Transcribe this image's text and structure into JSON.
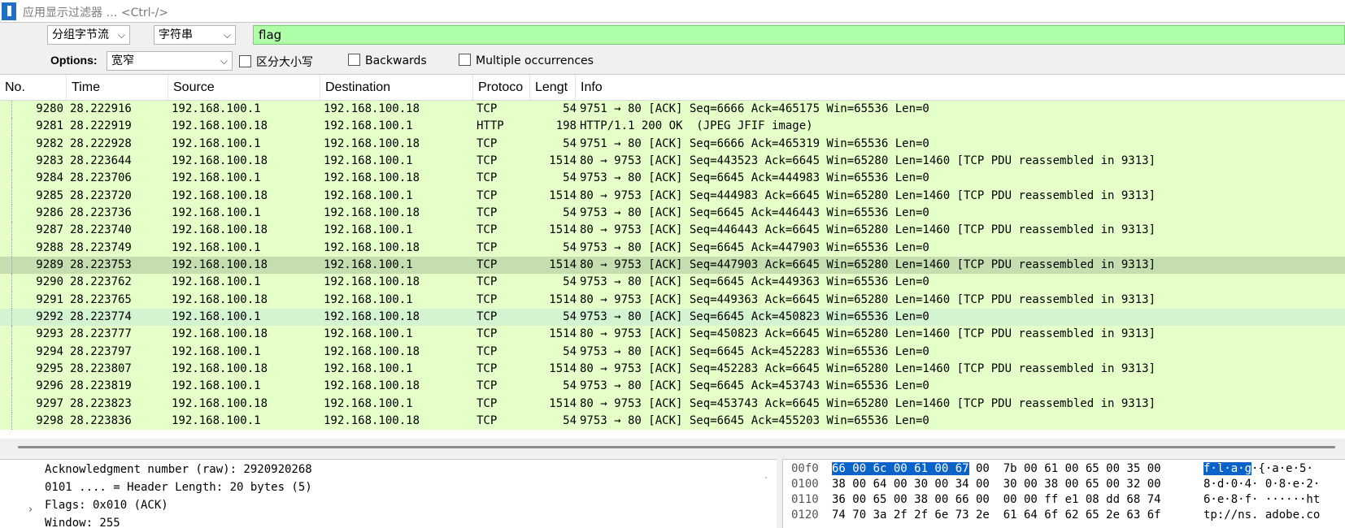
{
  "filter": {
    "placeholder": "应用显示过滤器 … <Ctrl-/>"
  },
  "find": {
    "scope": "分组字节流",
    "type": "字符串",
    "search_value": "flag",
    "options_label": "Options:",
    "charset": "宽窄",
    "case_sensitive": "区分大小写",
    "backwards": "Backwards",
    "multiple": "Multiple occurrences"
  },
  "columns": [
    "No.",
    "Time",
    "Source",
    "Destination",
    "Protoco",
    "Lengt",
    "Info"
  ],
  "packets": [
    [
      "9280",
      "28.222916",
      "192.168.100.1",
      "192.168.100.18",
      "TCP",
      "54",
      "9751 → 80 [ACK] Seq=6666 Ack=465175 Win=65536 Len=0"
    ],
    [
      "9281",
      "28.222919",
      "192.168.100.18",
      "192.168.100.1",
      "HTTP",
      "198",
      "HTTP/1.1 200 OK  (JPEG JFIF image)"
    ],
    [
      "9282",
      "28.222928",
      "192.168.100.1",
      "192.168.100.18",
      "TCP",
      "54",
      "9751 → 80 [ACK] Seq=6666 Ack=465319 Win=65536 Len=0"
    ],
    [
      "9283",
      "28.223644",
      "192.168.100.18",
      "192.168.100.1",
      "TCP",
      "1514",
      "80 → 9753 [ACK] Seq=443523 Ack=6645 Win=65280 Len=1460 [TCP PDU reassembled in 9313]"
    ],
    [
      "9284",
      "28.223706",
      "192.168.100.1",
      "192.168.100.18",
      "TCP",
      "54",
      "9753 → 80 [ACK] Seq=6645 Ack=444983 Win=65536 Len=0"
    ],
    [
      "9285",
      "28.223720",
      "192.168.100.18",
      "192.168.100.1",
      "TCP",
      "1514",
      "80 → 9753 [ACK] Seq=444983 Ack=6645 Win=65280 Len=1460 [TCP PDU reassembled in 9313]"
    ],
    [
      "9286",
      "28.223736",
      "192.168.100.1",
      "192.168.100.18",
      "TCP",
      "54",
      "9753 → 80 [ACK] Seq=6645 Ack=446443 Win=65536 Len=0"
    ],
    [
      "9287",
      "28.223740",
      "192.168.100.18",
      "192.168.100.1",
      "TCP",
      "1514",
      "80 → 9753 [ACK] Seq=446443 Ack=6645 Win=65280 Len=1460 [TCP PDU reassembled in 9313]"
    ],
    [
      "9288",
      "28.223749",
      "192.168.100.1",
      "192.168.100.18",
      "TCP",
      "54",
      "9753 → 80 [ACK] Seq=6645 Ack=447903 Win=65536 Len=0"
    ],
    [
      "9289",
      "28.223753",
      "192.168.100.18",
      "192.168.100.1",
      "TCP",
      "1514",
      "80 → 9753 [ACK] Seq=447903 Ack=6645 Win=65280 Len=1460 [TCP PDU reassembled in 9313]"
    ],
    [
      "9290",
      "28.223762",
      "192.168.100.1",
      "192.168.100.18",
      "TCP",
      "54",
      "9753 → 80 [ACK] Seq=6645 Ack=449363 Win=65536 Len=0"
    ],
    [
      "9291",
      "28.223765",
      "192.168.100.18",
      "192.168.100.1",
      "TCP",
      "1514",
      "80 → 9753 [ACK] Seq=449363 Ack=6645 Win=65280 Len=1460 [TCP PDU reassembled in 9313]"
    ],
    [
      "9292",
      "28.223774",
      "192.168.100.1",
      "192.168.100.18",
      "TCP",
      "54",
      "9753 → 80 [ACK] Seq=6645 Ack=450823 Win=65536 Len=0"
    ],
    [
      "9293",
      "28.223777",
      "192.168.100.18",
      "192.168.100.1",
      "TCP",
      "1514",
      "80 → 9753 [ACK] Seq=450823 Ack=6645 Win=65280 Len=1460 [TCP PDU reassembled in 9313]"
    ],
    [
      "9294",
      "28.223797",
      "192.168.100.1",
      "192.168.100.18",
      "TCP",
      "54",
      "9753 → 80 [ACK] Seq=6645 Ack=452283 Win=65536 Len=0"
    ],
    [
      "9295",
      "28.223807",
      "192.168.100.18",
      "192.168.100.1",
      "TCP",
      "1514",
      "80 → 9753 [ACK] Seq=452283 Ack=6645 Win=65280 Len=1460 [TCP PDU reassembled in 9313]"
    ],
    [
      "9296",
      "28.223819",
      "192.168.100.1",
      "192.168.100.18",
      "TCP",
      "54",
      "9753 → 80 [ACK] Seq=6645 Ack=453743 Win=65536 Len=0"
    ],
    [
      "9297",
      "28.223823",
      "192.168.100.18",
      "192.168.100.1",
      "TCP",
      "1514",
      "80 → 9753 [ACK] Seq=453743 Ack=6645 Win=65280 Len=1460 [TCP PDU reassembled in 9313]"
    ],
    [
      "9298",
      "28.223836",
      "192.168.100.1",
      "192.168.100.18",
      "TCP",
      "54",
      "9753 → 80 [ACK] Seq=6645 Ack=455203 Win=65536 Len=0"
    ]
  ],
  "selected_packet": "9289",
  "hover_packet": "9292",
  "details": [
    "Acknowledgment number (raw): 2920920268",
    "0101 .... = Header Length: 20 bytes (5)",
    "Flags: 0x010 (ACK)",
    "Window: 255"
  ],
  "bytes": [
    {
      "offset": "00f0",
      "hex_hl": "66 00 6c 00 61 00 67",
      "hex_rest": " 00  7b 00 61 00 65 00 35 00",
      "ascii_hl": "f·l·a·g",
      "ascii_rest": "·{·a·e·5·"
    },
    {
      "offset": "0100",
      "hex_hl": "",
      "hex_rest": "38 00 64 00 30 00 34 00  30 00 38 00 65 00 32 00",
      "ascii_hl": "",
      "ascii_rest": "8·d·0·4· 0·8·e·2·"
    },
    {
      "offset": "0110",
      "hex_hl": "",
      "hex_rest": "36 00 65 00 38 00 66 00  00 00 ff e1 08 dd 68 74",
      "ascii_hl": "",
      "ascii_rest": "6·e·8·f· ······ht"
    },
    {
      "offset": "0120",
      "hex_hl": "",
      "hex_rest": "74 70 3a 2f 2f 6e 73 2e  61 64 6f 62 65 2e 63 6f",
      "ascii_hl": "",
      "ascii_rest": "tp://ns. adobe.co"
    }
  ],
  "colors": {
    "row_bg": "#e4ffc7",
    "selected_bg": "#c5deb0",
    "search_bg": "#afffa8",
    "highlight": "#0a63c9"
  }
}
